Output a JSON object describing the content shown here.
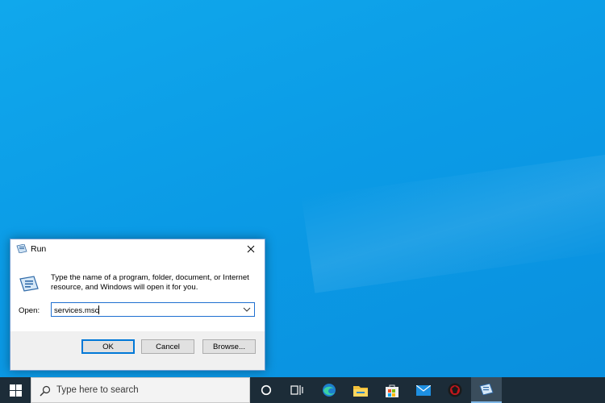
{
  "dialog": {
    "title": "Run",
    "description": "Type the name of a program, folder, document, or Internet resource, and Windows will open it for you.",
    "open_label": "Open:",
    "open_value": "services.msc",
    "ok_label": "OK",
    "cancel_label": "Cancel",
    "browse_label": "Browse..."
  },
  "taskbar": {
    "search_placeholder": "Type here to search",
    "icons": [
      "windows-start-icon",
      "cortana-icon",
      "task-view-icon",
      "edge-icon",
      "file-explorer-icon",
      "store-icon",
      "mail-icon",
      "red-app-icon",
      "run-app-icon"
    ]
  },
  "colors": {
    "desktop": "#0b9be6",
    "taskbar": "#1c2c38",
    "accent": "#0078d7"
  }
}
